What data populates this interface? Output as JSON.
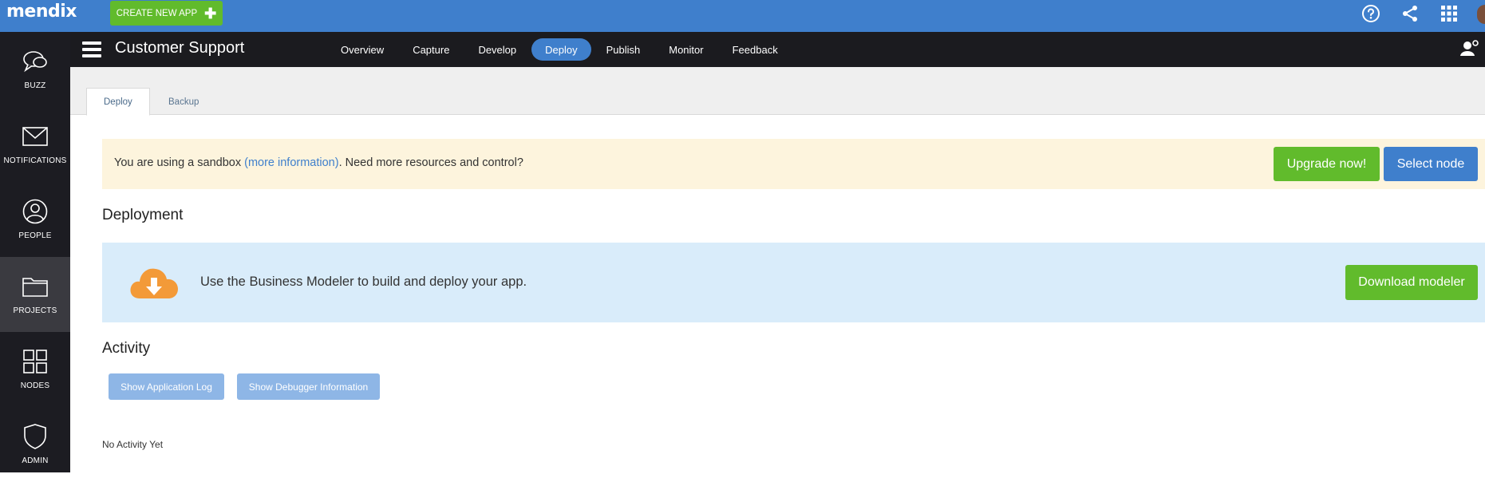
{
  "topbar": {
    "logo": "mendix",
    "create_label": "CREATE NEW APP",
    "create_icon": "plus-icon",
    "icons": [
      "help-icon",
      "share-icon",
      "apps-grid-icon"
    ]
  },
  "sidebar": {
    "items": [
      {
        "label": "BUZZ",
        "icon": "chat-bubbles-icon"
      },
      {
        "label": "NOTIFICATIONS",
        "icon": "envelope-icon"
      },
      {
        "label": "PEOPLE",
        "icon": "person-icon"
      },
      {
        "label": "PROJECTS",
        "icon": "folder-icon",
        "active": true
      },
      {
        "label": "NODES",
        "icon": "grid-icon"
      },
      {
        "label": "ADMIN",
        "icon": "shield-icon"
      }
    ]
  },
  "project": {
    "title": "Customer Support",
    "nav": [
      "Overview",
      "Capture",
      "Develop",
      "Deploy",
      "Publish",
      "Monitor",
      "Feedback"
    ],
    "active_nav": "Deploy"
  },
  "tabs": {
    "items": [
      "Deploy",
      "Backup"
    ],
    "active": "Deploy"
  },
  "sandbox": {
    "text_before": "You are using a sandbox ",
    "link": "(more information)",
    "text_after": ". Need more resources and control?",
    "upgrade_label": "Upgrade now!",
    "select_label": "Select node"
  },
  "deployment": {
    "heading": "Deployment",
    "message": "Use the Business Modeler to build and deploy your app.",
    "download_label": "Download modeler",
    "icon": "cloud-download-icon"
  },
  "activity": {
    "heading": "Activity",
    "log_label": "Show Application Log",
    "debugger_label": "Show Debugger Information",
    "empty_text": "No Activity Yet"
  },
  "colors": {
    "brand_blue": "#3f7fcc",
    "green": "#61bb2c",
    "dark": "#1b1b1f",
    "warning_bg": "#fdf4dd",
    "info_bg": "#d9ecfa",
    "light_blue_button": "#8eb6e6",
    "cloud_orange": "#f39a38"
  }
}
